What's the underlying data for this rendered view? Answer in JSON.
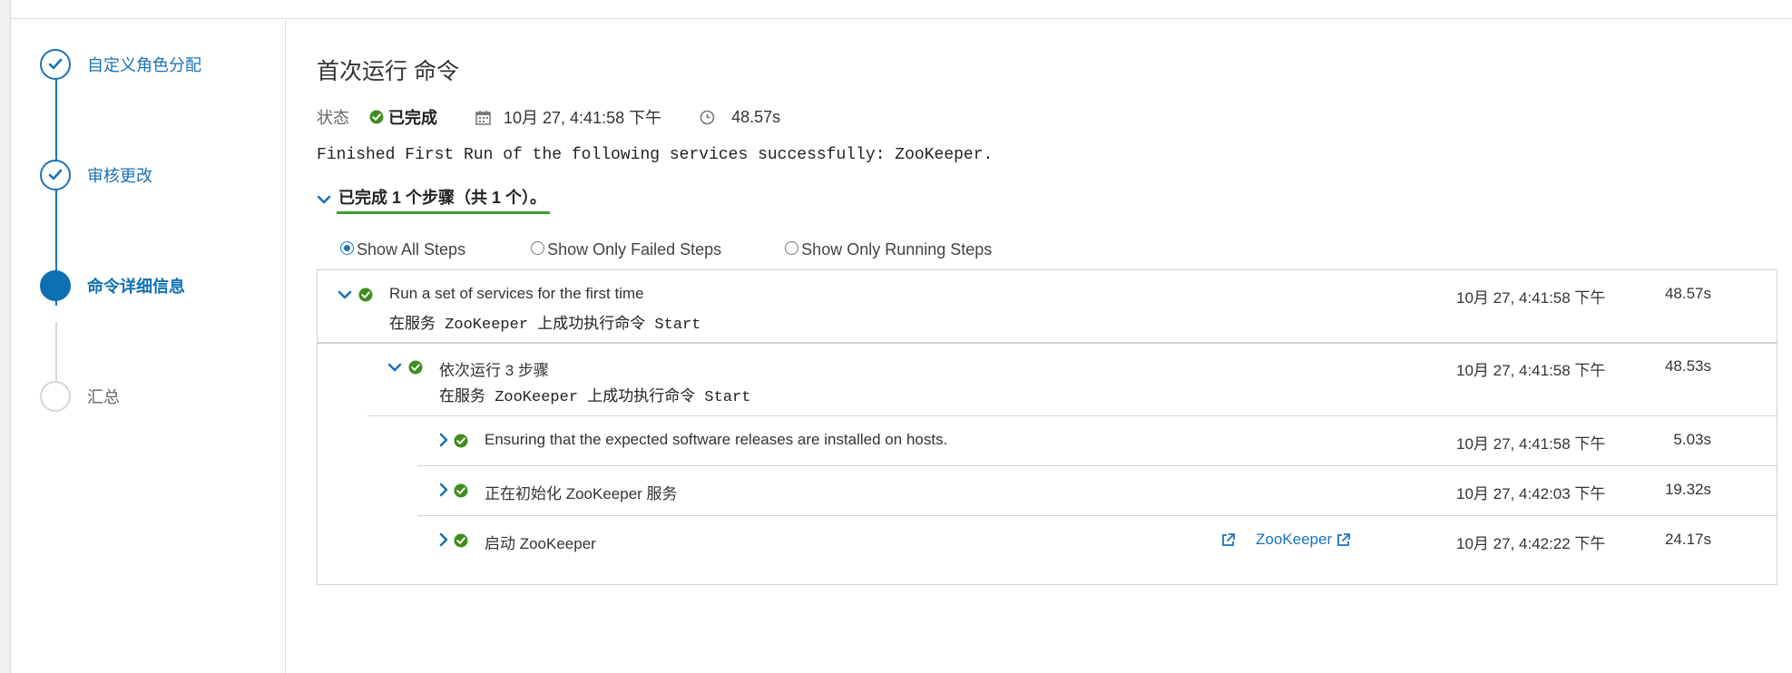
{
  "wizard": {
    "steps": [
      {
        "label": "自定义角色分配",
        "state": "done"
      },
      {
        "label": "审核更改",
        "state": "done"
      },
      {
        "label": "命令详细信息",
        "state": "current"
      },
      {
        "label": "汇总",
        "state": "todo"
      }
    ]
  },
  "command": {
    "title": "首次运行 命令",
    "status_label": "状态",
    "status_value": "已完成",
    "timestamp": "10月 27, 4:41:58 下午",
    "duration": "48.57s",
    "message": "Finished First Run of the following services successfully: ZooKeeper.",
    "summary": "已完成 1 个步骤（共 1 个）。"
  },
  "filters": {
    "all": "Show All Steps",
    "failed": "Show Only Failed Steps",
    "running": "Show Only Running Steps",
    "selected": "all"
  },
  "steps": {
    "root": {
      "title": "Run a set of services for the first time",
      "sub": "在服务 ZooKeeper 上成功执行命令 Start",
      "timestamp": "10月 27, 4:41:58 下午",
      "duration": "48.57s"
    },
    "sequence": {
      "title": "依次运行 3 步骤",
      "sub": "在服务 ZooKeeper 上成功执行命令 Start",
      "timestamp": "10月 27, 4:41:58 下午",
      "duration": "48.53s"
    },
    "children": [
      {
        "title": "Ensuring that the expected software releases are installed on hosts.",
        "timestamp": "10月 27, 4:41:58 下午",
        "duration": "5.03s"
      },
      {
        "title": "正在初始化 ZooKeeper 服务",
        "timestamp": "10月 27, 4:42:03 下午",
        "duration": "19.32s"
      },
      {
        "title": "启动 ZooKeeper",
        "timestamp": "10月 27, 4:42:22 下午",
        "duration": "24.17s",
        "link": "ZooKeeper"
      }
    ]
  },
  "colors": {
    "accent": "#1b72b8",
    "success": "#3f8e1c",
    "underline": "#3f9c35"
  }
}
